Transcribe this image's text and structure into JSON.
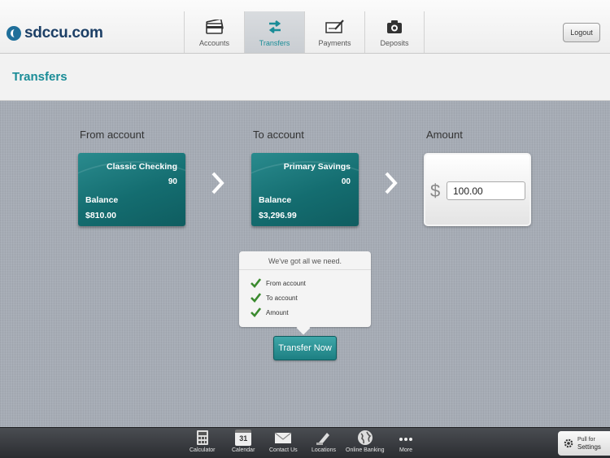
{
  "header": {
    "logo_text": "sdccu.com",
    "tabs": [
      {
        "label": "Accounts",
        "icon": "accounts-icon"
      },
      {
        "label": "Transfers",
        "icon": "transfers-icon",
        "active": true
      },
      {
        "label": "Payments",
        "icon": "payments-icon"
      },
      {
        "label": "Deposits",
        "icon": "deposits-icon"
      }
    ],
    "logout_label": "Logout"
  },
  "page": {
    "title": "Transfers"
  },
  "transfer": {
    "from_label": "From account",
    "to_label": "To account",
    "amount_label": "Amount",
    "from_account": {
      "name": "Classic Checking",
      "number": "90",
      "balance_label": "Balance",
      "balance": "$810.00"
    },
    "to_account": {
      "name": "Primary Savings",
      "number": "00",
      "balance_label": "Balance",
      "balance": "$3,296.99"
    },
    "currency_symbol": "$",
    "amount_value": "100.00"
  },
  "checklist": {
    "title": "We've got all we need.",
    "items": [
      "From account",
      "To account",
      "Amount"
    ]
  },
  "transfer_button_label": "Transfer Now",
  "bottom_nav": [
    {
      "label": "Calculator",
      "icon": "calculator-icon"
    },
    {
      "label": "Calendar",
      "icon": "calendar-icon",
      "icon_text": "31"
    },
    {
      "label": "Contact Us",
      "icon": "mail-icon"
    },
    {
      "label": "Locations",
      "icon": "locations-icon"
    },
    {
      "label": "Online Banking",
      "icon": "globe-icon"
    },
    {
      "label": "More",
      "icon": "more-icon"
    }
  ],
  "pull": {
    "line1": "Pull for",
    "line2": "Settings"
  },
  "colors": {
    "accent": "#1a8c97",
    "card": "#146d70"
  }
}
